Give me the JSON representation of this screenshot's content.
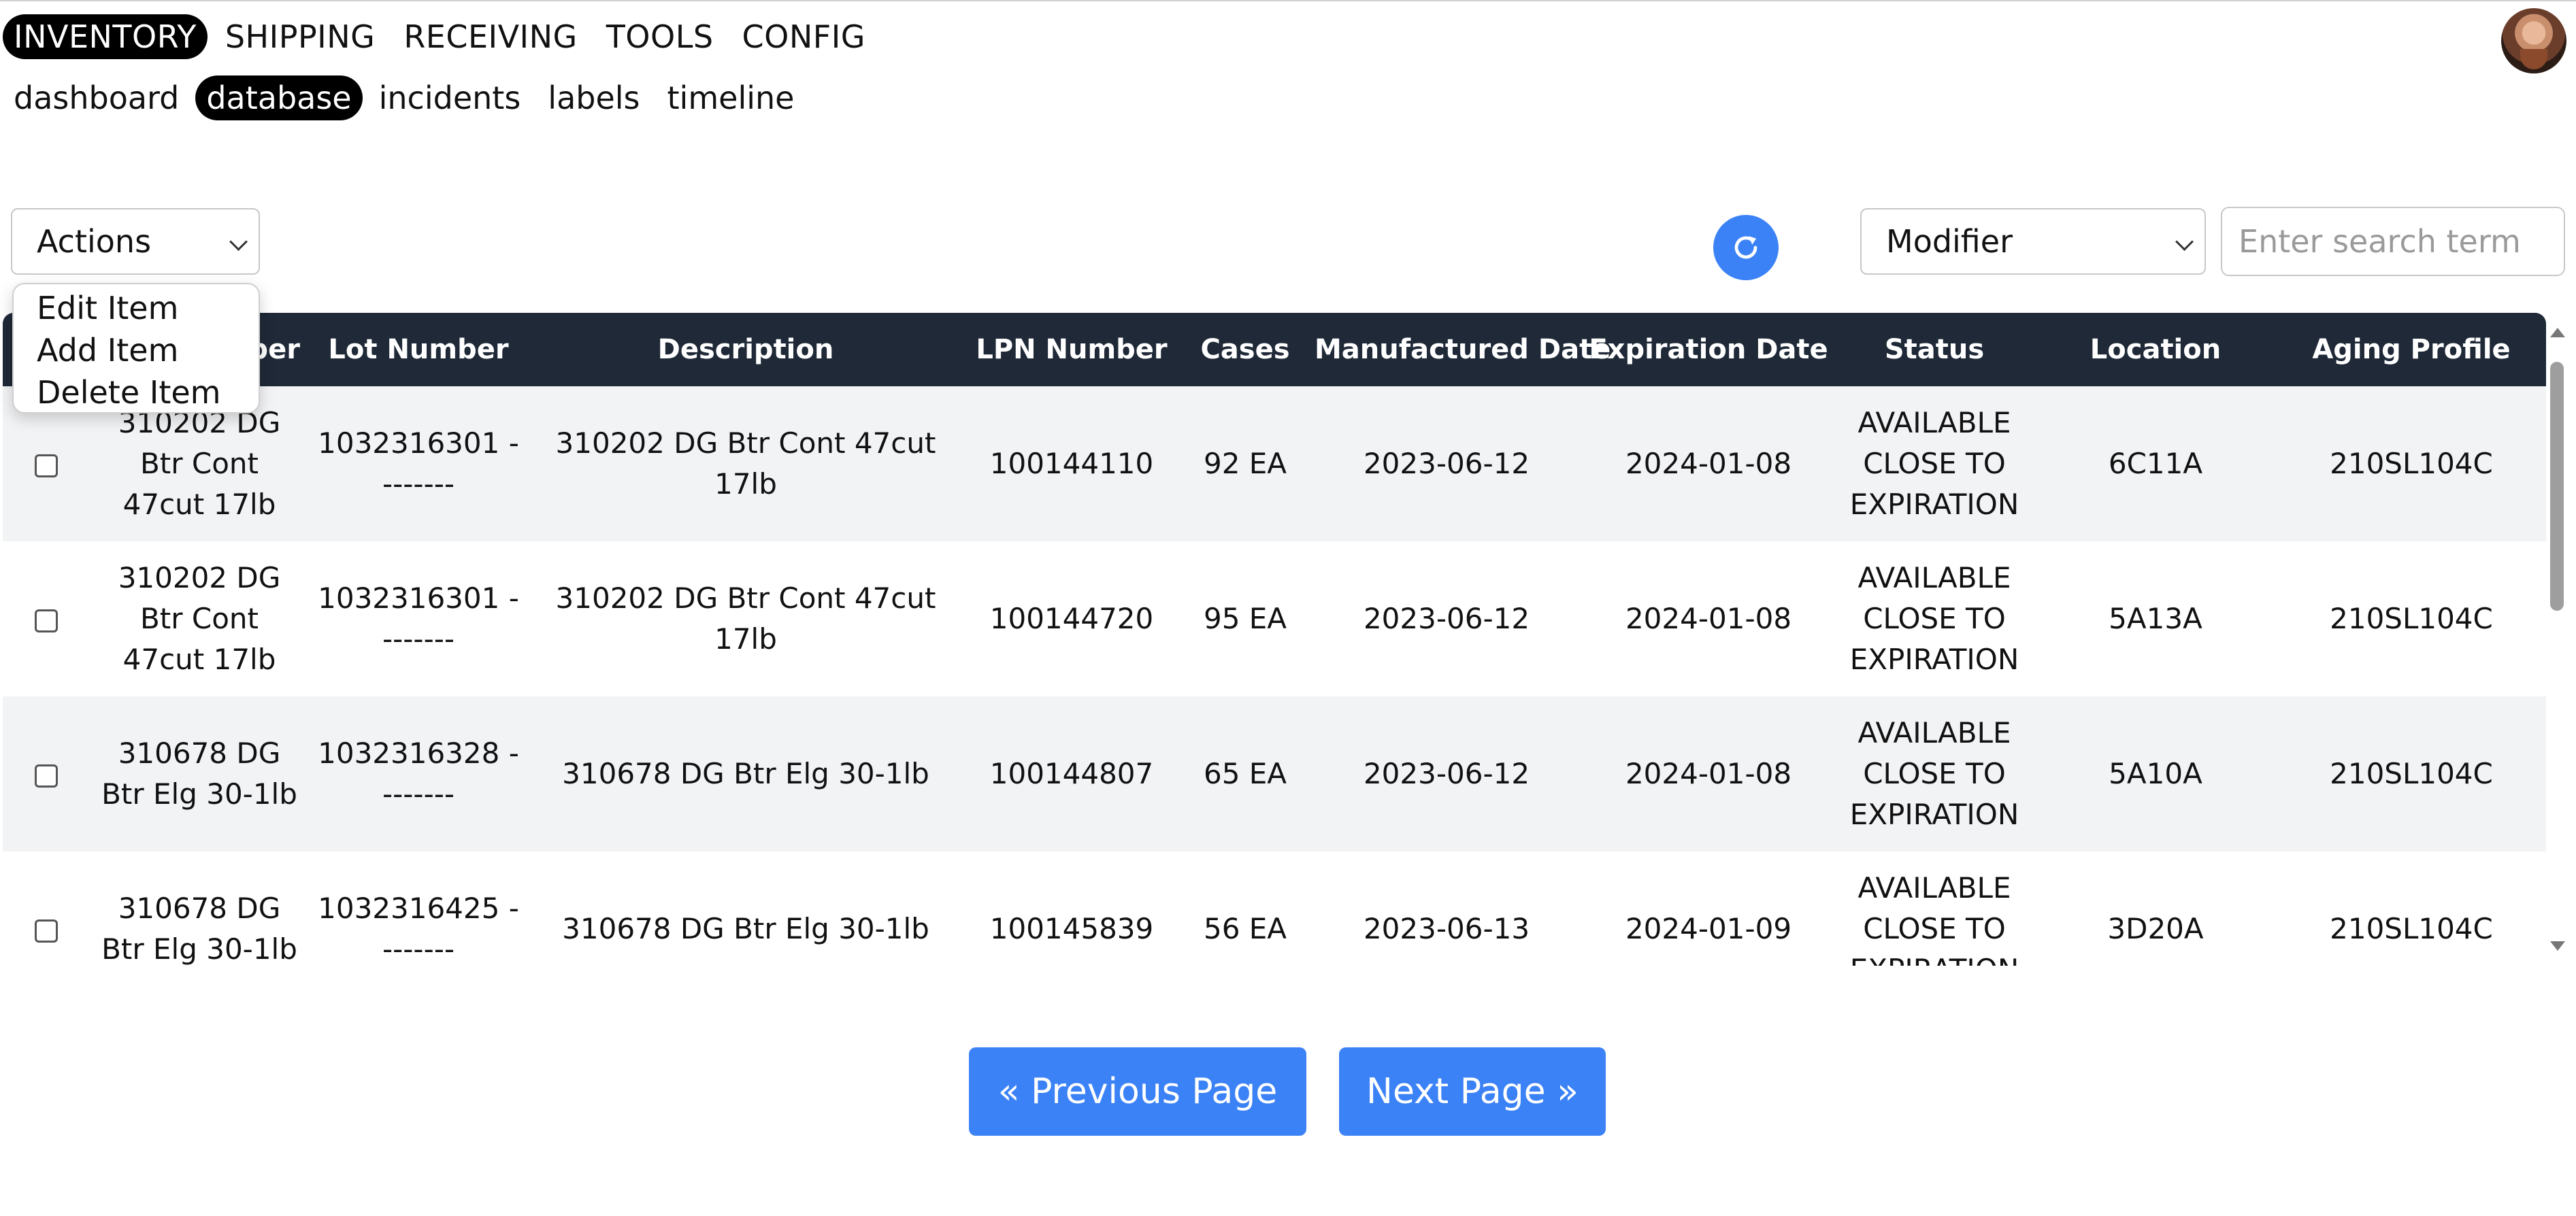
{
  "main_nav": {
    "items": [
      {
        "label": "INVENTORY",
        "active": true
      },
      {
        "label": "SHIPPING",
        "active": false
      },
      {
        "label": "RECEIVING",
        "active": false
      },
      {
        "label": "TOOLS",
        "active": false
      },
      {
        "label": "CONFIG",
        "active": false
      }
    ]
  },
  "sub_nav": {
    "items": [
      {
        "label": "dashboard",
        "active": false
      },
      {
        "label": "database",
        "active": true
      },
      {
        "label": "incidents",
        "active": false
      },
      {
        "label": "labels",
        "active": false
      },
      {
        "label": "timeline",
        "active": false
      }
    ]
  },
  "toolbar": {
    "actions_label": "Actions",
    "actions_menu": [
      "Edit Item",
      "Add Item",
      "Delete Item"
    ],
    "refresh_icon": "refresh-icon",
    "modifier_label": "Modifier",
    "search_placeholder": "Enter search term"
  },
  "table": {
    "columns": [
      "",
      "Item Number",
      "Lot Number",
      "Description",
      "LPN Number",
      "Cases",
      "Manufactured Date",
      "Expiration Date",
      "Status",
      "Location",
      "Aging Profile"
    ],
    "rows": [
      {
        "item": "310202 DG Btr Cont 47cut 17lb",
        "lot": "1032316301 --------",
        "description": "310202 DG Btr Cont 47cut 17lb",
        "lpn": "100144110",
        "cases": "92 EA",
        "manufactured": "2023-06-12",
        "expiration": "2024-01-08",
        "status": "AVAILABLE CLOSE TO EXPIRATION",
        "location": "6C11A",
        "aging": "210SL104C"
      },
      {
        "item": "310202 DG Btr Cont 47cut 17lb",
        "lot": "1032316301 --------",
        "description": "310202 DG Btr Cont 47cut 17lb",
        "lpn": "100144720",
        "cases": "95 EA",
        "manufactured": "2023-06-12",
        "expiration": "2024-01-08",
        "status": "AVAILABLE CLOSE TO EXPIRATION",
        "location": "5A13A",
        "aging": "210SL104C"
      },
      {
        "item": "310678 DG Btr Elg 30-1lb",
        "lot": "1032316328 --------",
        "description": "310678 DG Btr Elg 30-1lb",
        "lpn": "100144807",
        "cases": "65 EA",
        "manufactured": "2023-06-12",
        "expiration": "2024-01-08",
        "status": "AVAILABLE CLOSE TO EXPIRATION",
        "location": "5A10A",
        "aging": "210SL104C"
      },
      {
        "item": "310678 DG Btr Elg 30-1lb",
        "lot": "1032316425 --------",
        "description": "310678 DG Btr Elg 30-1lb",
        "lpn": "100145839",
        "cases": "56 EA",
        "manufactured": "2023-06-13",
        "expiration": "2024-01-09",
        "status": "AVAILABLE CLOSE TO EXPIRATION",
        "location": "3D20A",
        "aging": "210SL104C"
      }
    ]
  },
  "pagination": {
    "prev_label": "« Previous Page",
    "next_label": "Next Page »"
  },
  "colors": {
    "header_bg": "#1f2937",
    "accent": "#3b82f6",
    "row_alt": "#f2f3f5"
  }
}
